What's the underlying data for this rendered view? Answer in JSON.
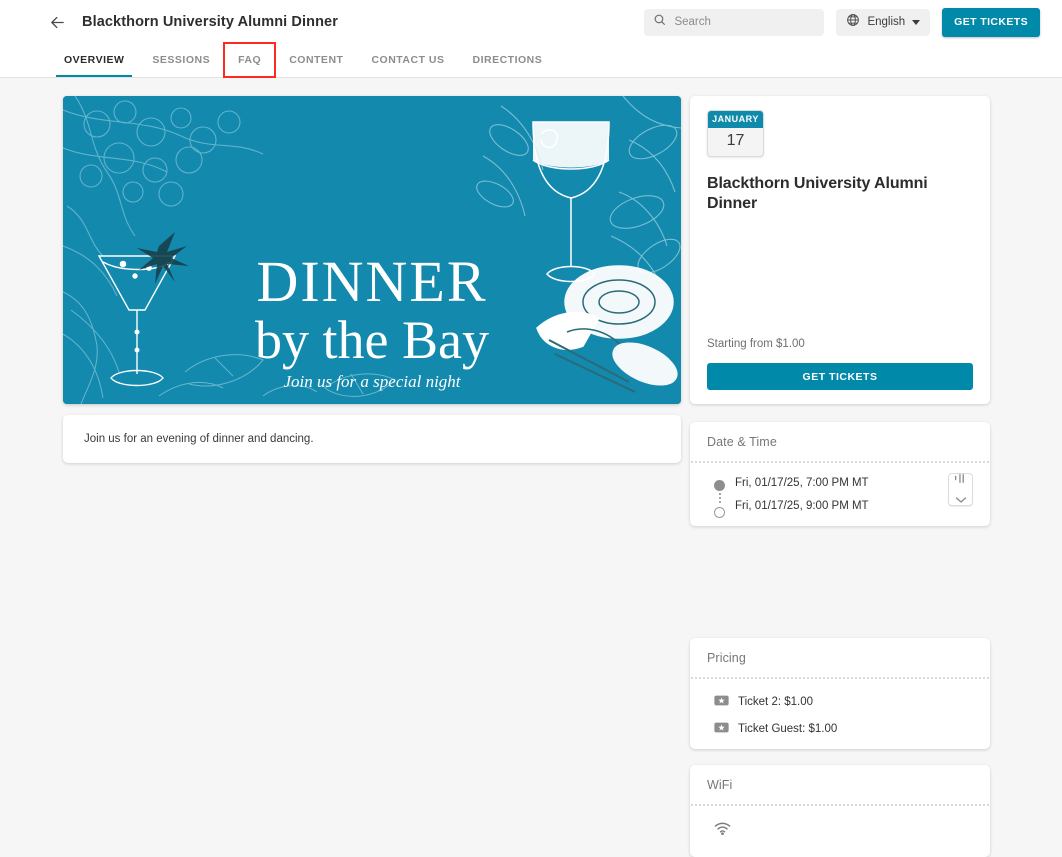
{
  "topbar": {
    "back_icon": "arrow-left-icon",
    "event_title": "Blackthorn University Alumni Dinner",
    "search": {
      "icon": "search-icon",
      "value": "",
      "placeholder": "Search"
    },
    "language": {
      "icon": "globe-icon",
      "label": "English",
      "caret": "caret-down-icon"
    },
    "get_tickets_label": "GET TICKETS"
  },
  "tabs": [
    {
      "label": "OVERVIEW",
      "active": true,
      "highlighted": false
    },
    {
      "label": "SESSIONS",
      "active": false,
      "highlighted": false
    },
    {
      "label": "FAQ",
      "active": false,
      "highlighted": true
    },
    {
      "label": "CONTENT",
      "active": false,
      "highlighted": false
    },
    {
      "label": "CONTACT US",
      "active": false,
      "highlighted": false
    },
    {
      "label": "DIRECTIONS",
      "active": false,
      "highlighted": false
    }
  ],
  "hero": {
    "title_line1": "DINNER",
    "title_line2": "by the Bay",
    "subtitle": "Join us for a special night",
    "background_color": "#1389ad"
  },
  "description": {
    "text": "Join us for an evening of dinner and dancing."
  },
  "info": {
    "date_month": "JANUARY",
    "date_day": "17",
    "title": "Blackthorn University Alumni Dinner",
    "starting_from": "Starting from $1.00",
    "get_tickets_label": "GET TICKETS"
  },
  "date_time": {
    "heading": "Date & Time",
    "start": "Fri, 01/17/25, 7:00 PM MT",
    "end": "Fri, 01/17/25, 9:00 PM MT",
    "add_calendar_icon": "add-to-calendar-icon",
    "expand_icon": "chevron-down-icon"
  },
  "pricing": {
    "heading": "Pricing",
    "items": [
      {
        "icon": "ticket-icon",
        "label": "Ticket 2: $1.00"
      },
      {
        "icon": "ticket-icon",
        "label": "Ticket Guest: $1.00"
      }
    ]
  },
  "wifi": {
    "heading": "WiFi",
    "icon": "wifi-icon"
  },
  "colors": {
    "brand_teal": "#0089a8",
    "banner_teal": "#1389ad",
    "badge_teal": "#0f8aab",
    "highlight_red": "#ff2a1f",
    "page_background": "#f6f6f6"
  }
}
